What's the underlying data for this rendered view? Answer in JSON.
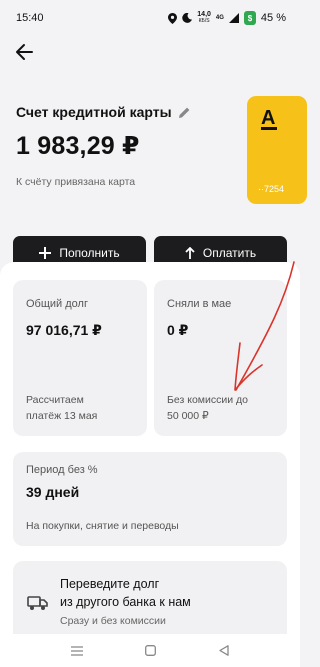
{
  "status": {
    "time": "15:40",
    "net_speed_value": "14,0",
    "net_speed_unit": "КБ/S",
    "signal": "4G",
    "battery_app_badge": "$",
    "battery": "45 %"
  },
  "account": {
    "title": "Счет кредитной карты",
    "balance": "1 983,29 ₽",
    "linked_text": "К счёту привязана карта"
  },
  "card": {
    "logo": "А",
    "number": "··7254"
  },
  "actions": {
    "topup_label": "Пополнить",
    "pay_label": "Оплатить"
  },
  "tiles": {
    "debt": {
      "label": "Общий долг",
      "value": "97 016,71 ₽",
      "note_line1": "Рассчитаем",
      "note_line2": "платёж 13 мая"
    },
    "withdraw": {
      "label": "Сняли в мае",
      "value": "0 ₽",
      "note_line1": "Без комиссии до",
      "note_line2": "50 000 ₽"
    },
    "grace": {
      "label": "Период без %",
      "value": "39 дней",
      "note": "На покупки, снятие и переводы"
    },
    "transfer": {
      "title_line1": "Переведите долг",
      "title_line2": "из другого банка к нам",
      "subtitle": "Сразу и без комиссии"
    }
  },
  "colors": {
    "card_yellow": "#f6c21a",
    "button_dark": "#1c1c1e",
    "annotation_red": "#d9342b"
  },
  "icons": {
    "back": "arrow-left",
    "edit": "pencil",
    "topup": "plus",
    "pay": "arrow-up",
    "transfer": "truck"
  }
}
